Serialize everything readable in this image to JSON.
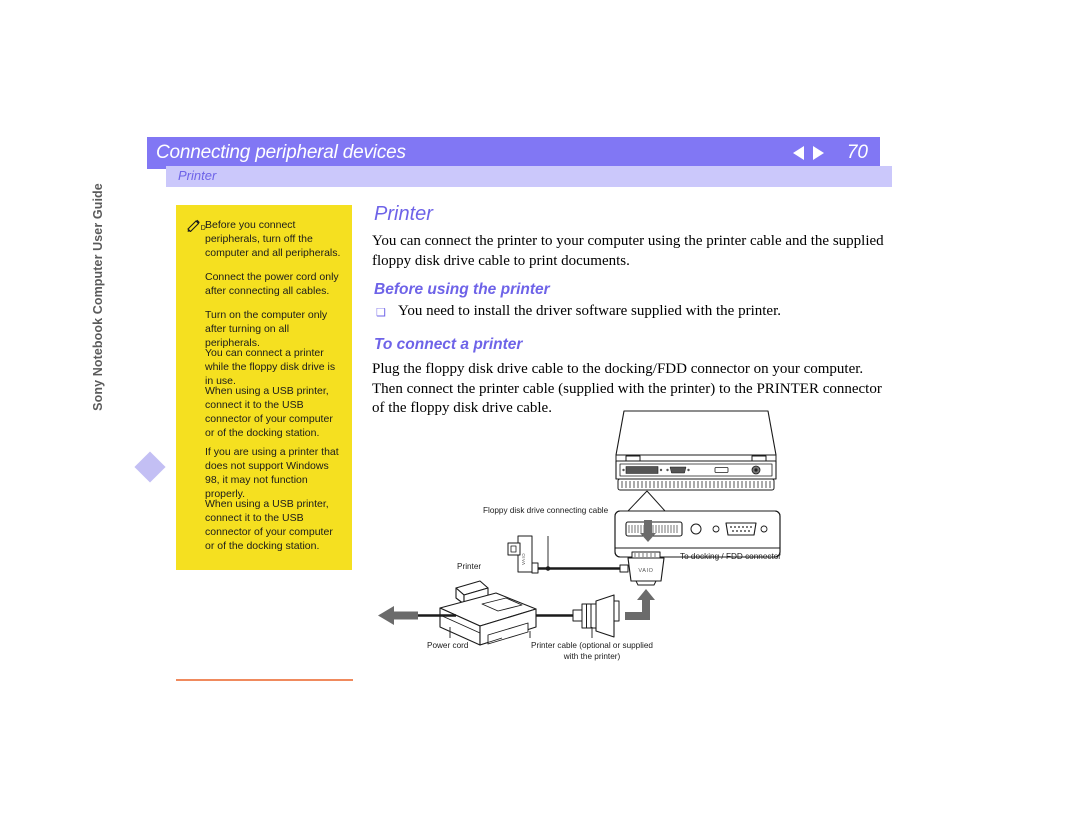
{
  "header": {
    "title": "Connecting peripheral devices",
    "page_number": "70",
    "subtitle": "Printer",
    "nav_prev_icon": "triangle-left-icon",
    "nav_next_icon": "triangle-right-icon",
    "bar_color": "#8177f4",
    "subbar_color": "#cbc8fb"
  },
  "side": {
    "guide_title": "Sony Notebook Computer User Guide",
    "diamond_color": "#c3bff4"
  },
  "note_box": {
    "background": "#f5e020",
    "icon": "pencil-note-icon",
    "paragraphs": [
      "Before you connect peripherals, turn off the computer and all peripherals.",
      "Connect the power cord only after connecting all cables.",
      "Turn on the computer only after turning on all peripherals.",
      "You can connect a printer while the floppy disk drive is in use.",
      "When using a USB printer, connect it to the USB connector of your computer or of the docking station.",
      "If you are using a printer that does not support Windows 98, it may not function properly.",
      "When using a USB printer, connect it to the USB connector of your computer or of the docking station."
    ]
  },
  "main": {
    "title": "Printer",
    "intro": "You can connect the printer to your computer using the printer cable and the supplied floppy disk drive cable to print documents.",
    "heading_before": "Before using the printer",
    "bullet_marker": "❑",
    "bullet_text": "You need to install the driver software supplied with the printer.",
    "heading_connect": "To connect a printer",
    "steps": "Plug the floppy disk drive cable to the docking/FDD connector on your computer. Then connect the printer cable (supplied with the printer) to the PRINTER connector of the floppy disk drive cable.",
    "accent_color": "#6e63e8"
  },
  "diagram": {
    "labels": {
      "fdd_cable": "Floppy disk drive connecting cable",
      "printer": "Printer",
      "docking_connector": "To docking / FDD connector",
      "power_cord": "Power cord",
      "printer_cable_line1": "Printer cable (optional or supplied",
      "printer_cable_line2": "with the printer)"
    },
    "connector_brand": "VAIO",
    "parts": [
      "notebook-rear-view",
      "docking-fdd-connector-block",
      "vaio-cable-plug",
      "printer-cable-plug",
      "printer-body",
      "power-cord-arrow"
    ]
  },
  "footer": {
    "rule_color": "#f08a5d"
  }
}
